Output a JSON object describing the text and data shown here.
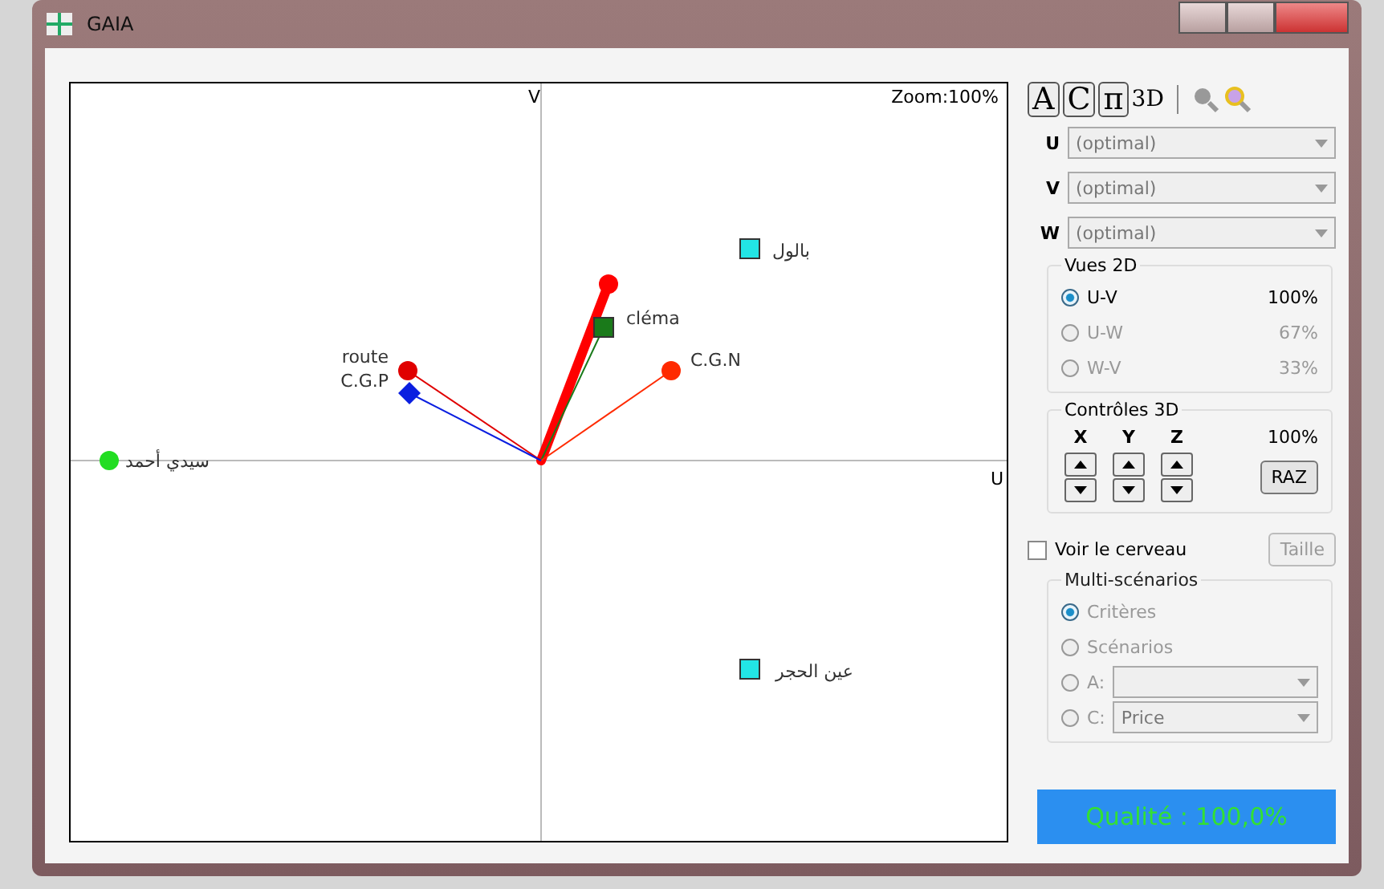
{
  "window": {
    "title": "GAIA"
  },
  "plot": {
    "axis_v": "V",
    "axis_u": "U",
    "zoom": "Zoom:100%",
    "points": [
      {
        "kind": "circle",
        "color": "#ff0000",
        "emphasized": true
      },
      {
        "label": "cléma",
        "kind": "square",
        "color": "#1a7a1a",
        "emphasized": false
      },
      {
        "label": "C.G.N",
        "kind": "circle",
        "color": "#ff2a00",
        "emphasized": false
      },
      {
        "label": "route",
        "kind": "circle",
        "color": "#e00000",
        "emphasized": false
      },
      {
        "label": "C.G.P",
        "kind": "diamond",
        "color": "#0a1ee0",
        "emphasized": false
      }
    ],
    "actions": [
      {
        "label": "سيدي أحمد",
        "kind": "circle",
        "color": "#22dd22"
      },
      {
        "label": "بالول",
        "kind": "square",
        "color": "#22e5e5"
      },
      {
        "label": "عين الحجر",
        "kind": "square",
        "color": "#22e5e5"
      }
    ]
  },
  "toolbar": {
    "buttons": [
      "A",
      "C",
      "π"
    ],
    "mode": "3D"
  },
  "axes": [
    {
      "label": "U",
      "value": "(optimal)"
    },
    {
      "label": "V",
      "value": "(optimal)"
    },
    {
      "label": "W",
      "value": "(optimal)"
    }
  ],
  "views_2d": {
    "title": "Vues 2D",
    "options": [
      {
        "label": "U-V",
        "percent": "100%",
        "selected": true
      },
      {
        "label": "U-W",
        "percent": "67%",
        "selected": false
      },
      {
        "label": "W-V",
        "percent": "33%",
        "selected": false
      }
    ]
  },
  "controls_3d": {
    "title": "Contrôles 3D",
    "axes": [
      "X",
      "Y",
      "Z"
    ],
    "percent": "100%",
    "reset": "RAZ"
  },
  "brain": {
    "label": "Voir le cerveau",
    "checked": false,
    "size_button": "Taille"
  },
  "multi": {
    "title": "Multi-scénarios",
    "options": [
      {
        "label": "Critères",
        "selected": true
      },
      {
        "label": "Scénarios",
        "selected": false
      },
      {
        "label": "A:",
        "selected": false,
        "kind": "dropdown"
      },
      {
        "label": "C:",
        "selected": false,
        "kind": "dropdown",
        "value": "Price"
      }
    ]
  },
  "quality": "Qualité : 100,0%"
}
